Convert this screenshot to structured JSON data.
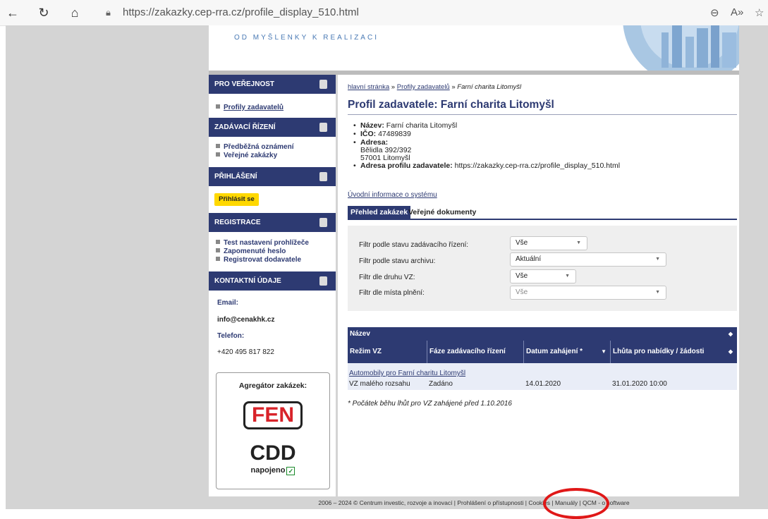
{
  "browser": {
    "url_host": "https://zakazky.cep-rra.cz",
    "url_path": "/profile_display_510.html"
  },
  "header": {
    "slogan": "OD MYŠLENKY K REALIZACI"
  },
  "sidebar": {
    "sections": [
      {
        "title": "PRO VEŘEJNOST"
      },
      {
        "title": "ZADÁVACÍ ŘÍZENÍ"
      },
      {
        "title": "PŘIHLÁŠENÍ"
      },
      {
        "title": "REGISTRACE"
      },
      {
        "title": "KONTAKTNÍ ÚDAJE"
      }
    ],
    "links": {
      "profily": "Profily zadavatelů",
      "predbezna": "Předběžná oznámení",
      "verejne": "Veřejné zakázky",
      "test": "Test nastavení prohlížeče",
      "zapomenute": "Zapomenuté heslo",
      "registrovat": "Registrovat dodavatele"
    },
    "login_button": "Přihlásit se",
    "contact": {
      "email_label": "Email:",
      "email": "info@cenakhk.cz",
      "phone_label": "Telefon:",
      "phone": "+420 495 817 822"
    },
    "aggregator": {
      "title": "Agregátor zakázek:",
      "fen": "FEN",
      "cdd": "CDD",
      "napojeno": "napojeno"
    }
  },
  "breadcrumb": {
    "home": "hlavní stránka",
    "sep": "»",
    "profiles": "Profily zadavatelů",
    "current": "Farní charita Litomyšl"
  },
  "title": "Profil zadavatele: Farní charita Litomyšl",
  "profile": {
    "name_label": "Název:",
    "name": "Farní charita Litomyšl",
    "ico_label": "IČO:",
    "ico": "47489839",
    "address_label": "Adresa:",
    "address_line1": "Bělidla 392/392",
    "address_line2": "57001 Litomyšl",
    "profile_url_label": "Adresa profilu zadavatele:",
    "profile_url": "https://zakazky.cep-rra.cz/profile_display_510.html"
  },
  "intro_link": "Úvodní informace o systému",
  "tabs": [
    "Přehled zakázek",
    "Veřejné dokumenty"
  ],
  "filters": [
    {
      "label": "Filtr podle stavu zadávacího řízení:",
      "value": "Vše"
    },
    {
      "label": "Filtr podle stavu archivu:",
      "value": "Aktuální"
    },
    {
      "label": "Filtr dle druhu VZ:",
      "value": "Vše"
    },
    {
      "label": "Filtr dle místa plnění:",
      "value": "Vše"
    }
  ],
  "table": {
    "col_name": "Název",
    "columns": [
      "Režim VZ",
      "Fáze zadávacího řízení",
      "Datum zahájení *",
      "Lhůta pro nabídky / žádosti"
    ],
    "rows": [
      {
        "name": "Automobily pro Farní charitu Litomyšl",
        "rezim": "VZ malého rozsahu",
        "faze": "Zadáno",
        "datum": "14.01.2020",
        "lhuta": "31.01.2020 10:00"
      }
    ]
  },
  "note": "* Počátek běhu lhůt pro VZ zahájené před 1.10.2016",
  "footer": "2006 – 2024 © Centrum investic, rozvoje a inovací  | Prohlášení o přístupnosti  | Cookies  | Manuály  | QCM - o software"
}
